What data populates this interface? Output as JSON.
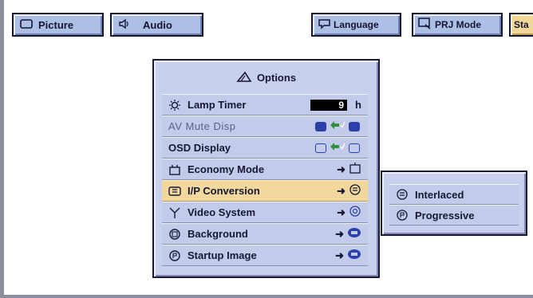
{
  "tabs": [
    {
      "label": "Picture",
      "icon": "monitor-icon"
    },
    {
      "label": "Audio",
      "icon": "speaker-icon"
    },
    {
      "label": "Language",
      "icon": "speech-bubble-icon"
    },
    {
      "label": "PRJ Mode",
      "icon": "projector-mode-icon"
    },
    {
      "label": "Sta",
      "icon": ""
    }
  ],
  "options": {
    "title": "Options",
    "rows": {
      "lamp_timer": {
        "label": "Lamp Timer",
        "value": "9",
        "unit": "h"
      },
      "av_mute": {
        "label": "AV Mute Disp"
      },
      "osd_display": {
        "label": "OSD Display"
      },
      "economy_mode": {
        "label": "Economy Mode"
      },
      "ip_conversion": {
        "label": "I/P Conversion"
      },
      "video_system": {
        "label": "Video System"
      },
      "background": {
        "label": "Background"
      },
      "startup_image": {
        "label": "Startup Image"
      }
    },
    "arrow": "➜"
  },
  "submenu": {
    "items": [
      {
        "label": "Interlaced"
      },
      {
        "label": "Progressive"
      }
    ]
  },
  "colors": {
    "panel": "#c9d0ee",
    "selected": "#f2d89d",
    "tab": "#aebfe6",
    "accent_blue": "#2d3fa8"
  }
}
